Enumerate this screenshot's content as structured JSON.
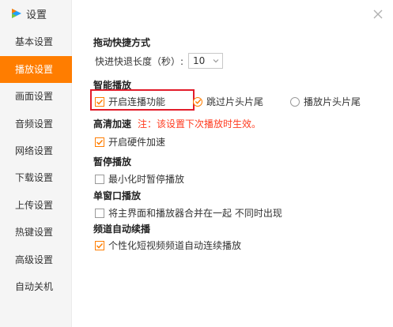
{
  "window": {
    "title": "设置",
    "colors": {
      "accent": "#ff7d00",
      "highlight": "#e21c2a",
      "note": "#ff3b1f",
      "sidebar_bg": "#f5f5f5"
    }
  },
  "sidebar": {
    "items": [
      {
        "label": "基本设置",
        "active": false
      },
      {
        "label": "播放设置",
        "active": true
      },
      {
        "label": "画面设置",
        "active": false
      },
      {
        "label": "音频设置",
        "active": false
      },
      {
        "label": "网络设置",
        "active": false
      },
      {
        "label": "下载设置",
        "active": false
      },
      {
        "label": "上传设置",
        "active": false
      },
      {
        "label": "热键设置",
        "active": false
      },
      {
        "label": "高级设置",
        "active": false
      },
      {
        "label": "自动关机",
        "active": false
      }
    ]
  },
  "main": {
    "drag_shortcut": {
      "title": "拖动快捷方式",
      "seek_label": "快进快退长度（秒）:",
      "seek_value": "10"
    },
    "smart_play": {
      "title": "智能播放",
      "continuous_label": "开启连播功能",
      "continuous_checked": true,
      "skip_label": "跳过片头片尾",
      "skip_selected": true,
      "play_label": "播放片头片尾",
      "play_selected": false
    },
    "hd_accel": {
      "title": "高清加速",
      "note": "注：该设置下次播放时生效。",
      "hw_label": "开启硬件加速",
      "hw_checked": true
    },
    "pause": {
      "title": "暂停播放",
      "minimize_label": "最小化时暂停播放",
      "minimize_checked": false
    },
    "single_window": {
      "title": "单窗口播放",
      "merge_label": "将主界面和播放器合并在一起 不同时出现",
      "merge_checked": false
    },
    "channel_auto": {
      "title": "频道自动续播",
      "auto_label": "个性化短视频频道自动连续播放",
      "auto_checked": true
    }
  }
}
